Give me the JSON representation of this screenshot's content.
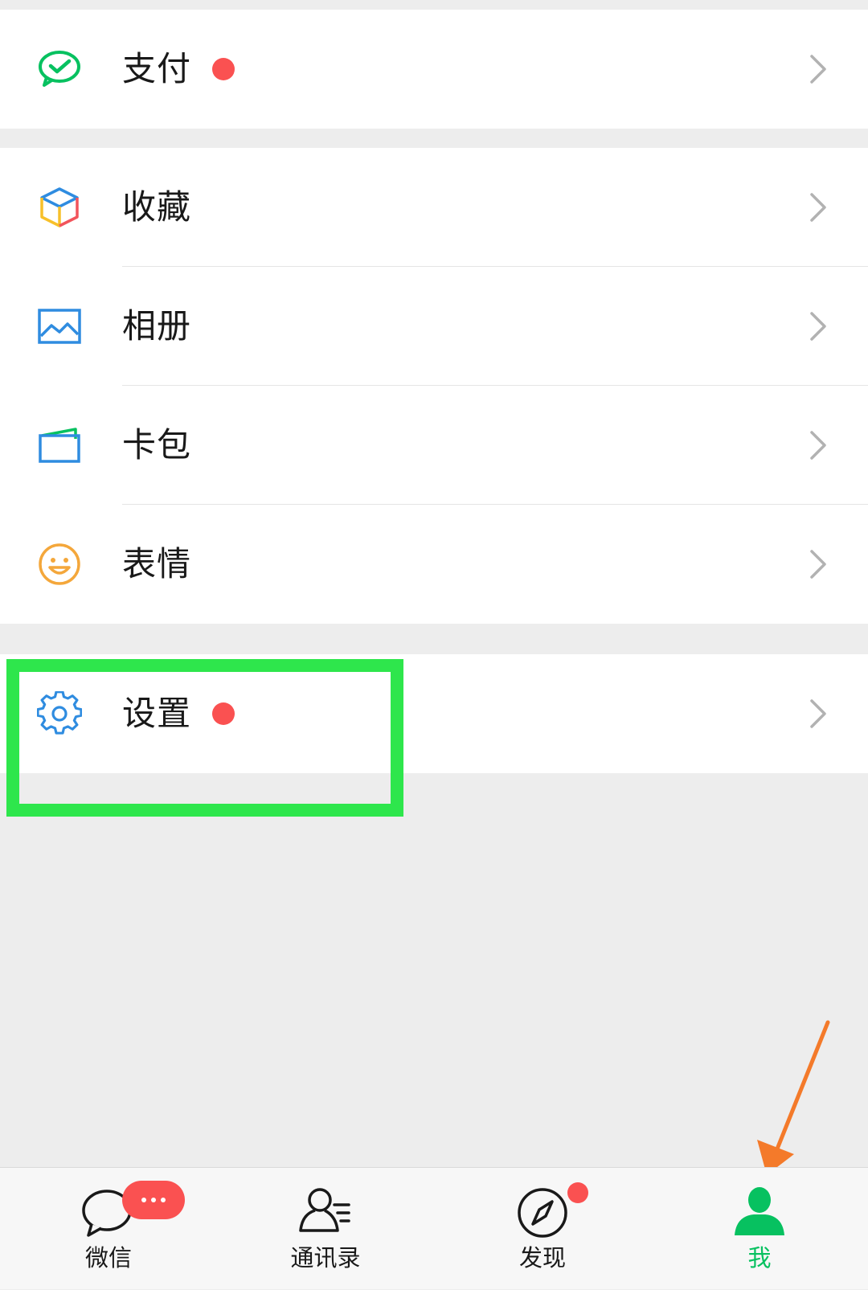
{
  "menu": {
    "pay": {
      "label": "支付",
      "icon": "wechat-pay-icon",
      "badge": true
    },
    "favorites": {
      "label": "收藏",
      "icon": "favorites-cube-icon"
    },
    "album": {
      "label": "相册",
      "icon": "album-image-icon"
    },
    "cards": {
      "label": "卡包",
      "icon": "card-wallet-icon"
    },
    "stickers": {
      "label": "表情",
      "icon": "smiley-icon"
    },
    "settings": {
      "label": "设置",
      "icon": "gear-icon",
      "badge": true
    }
  },
  "tabbar": {
    "chats": {
      "label": "微信",
      "icon": "chat-bubble-icon",
      "badge": "more-dots"
    },
    "contacts": {
      "label": "通讯录",
      "icon": "contacts-icon"
    },
    "discover": {
      "label": "发现",
      "icon": "compass-icon",
      "badge": true
    },
    "me": {
      "label": "我",
      "icon": "person-icon",
      "active": true
    }
  },
  "colors": {
    "active_green": "#07c160",
    "badge_red": "#fa5151",
    "highlight_green": "#2ee64c",
    "arrow_orange": "#f47a2a",
    "background": "#ededed"
  }
}
